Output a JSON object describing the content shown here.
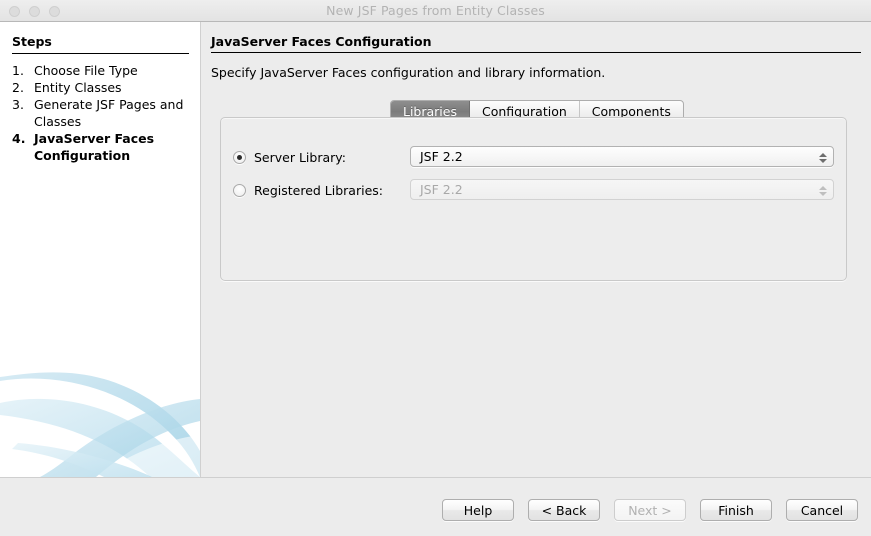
{
  "window": {
    "title": "New JSF Pages from Entity Classes",
    "controls": [
      {
        "name": "close-button"
      },
      {
        "name": "minimize-button"
      },
      {
        "name": "maximize-button"
      }
    ]
  },
  "sidebar": {
    "heading": "Steps",
    "steps": [
      {
        "number": "1.",
        "label": "Choose File Type",
        "current": false
      },
      {
        "number": "2.",
        "label": "Entity Classes",
        "current": false
      },
      {
        "number": "3.",
        "label": "Generate JSF Pages and Classes",
        "current": false
      },
      {
        "number": "4.",
        "label": "JavaServer Faces Configuration",
        "current": true
      }
    ]
  },
  "content": {
    "title": "JavaServer Faces Configuration",
    "subtitle": "Specify JavaServer Faces configuration and library information.",
    "tabs": [
      {
        "label": "Libraries",
        "selected": true
      },
      {
        "label": "Configuration",
        "selected": false
      },
      {
        "label": "Components",
        "selected": false
      }
    ],
    "options": {
      "server_library": {
        "caption": "Server Library:",
        "selected": true,
        "value": "JSF 2.2",
        "enabled": true
      },
      "registered_libraries": {
        "caption": "Registered Libraries:",
        "selected": false,
        "value": "JSF 2.2",
        "enabled": false
      }
    }
  },
  "footer": {
    "buttons": [
      {
        "label": "Help",
        "enabled": true
      },
      {
        "label": "< Back",
        "enabled": true
      },
      {
        "label": "Next >",
        "enabled": false
      },
      {
        "label": "Finish",
        "enabled": true
      },
      {
        "label": "Cancel",
        "enabled": true
      }
    ]
  },
  "colors": {
    "window_background": "#ececec",
    "sidebar_background": "#ffffff",
    "selected_tab": "#7c7c7c",
    "accent_graphic": "#b9dcec"
  }
}
